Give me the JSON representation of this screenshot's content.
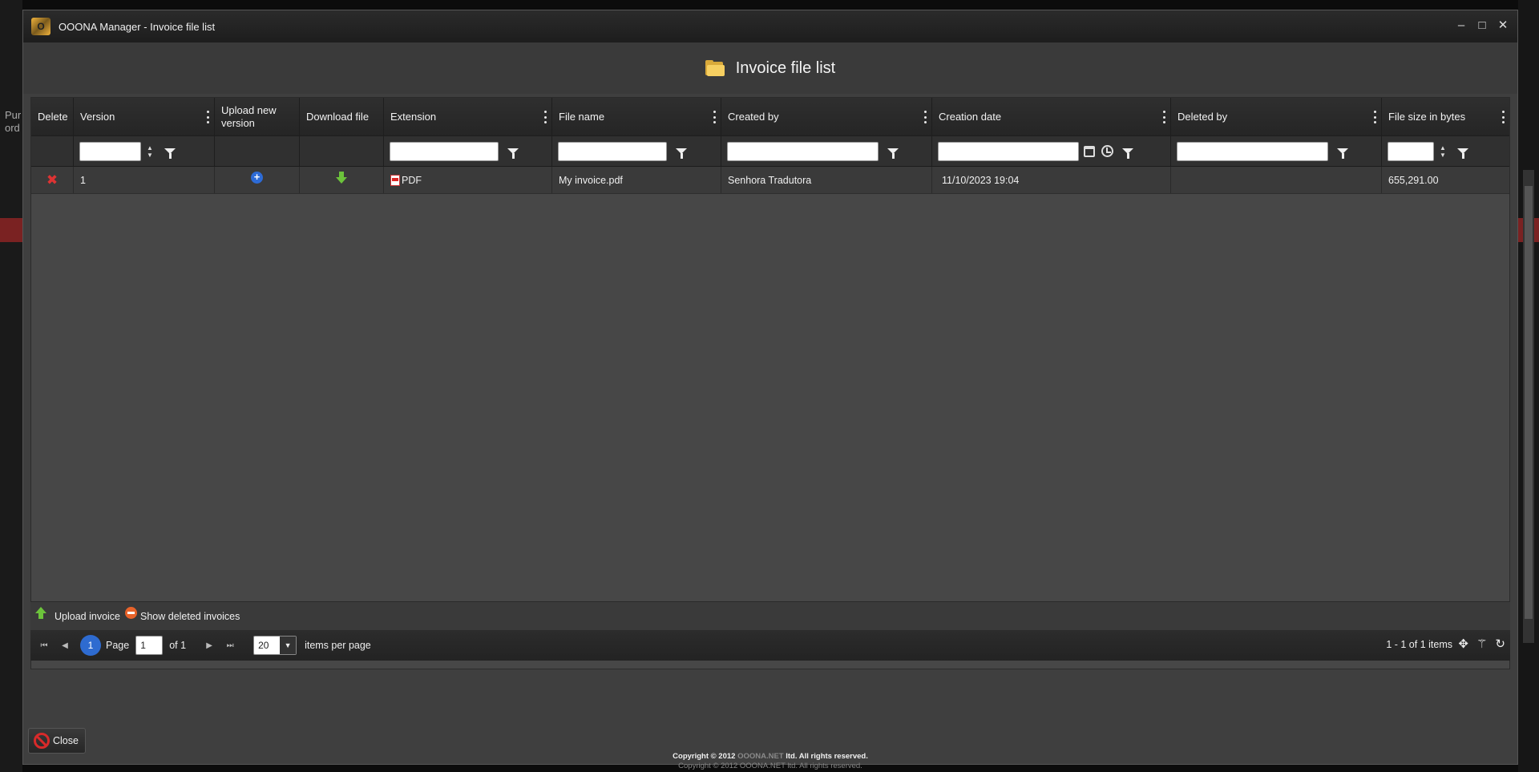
{
  "window": {
    "title": "OOONA Manager - Invoice file list",
    "logo_letter": "O",
    "controls": {
      "minimize": "–",
      "maximize": "□",
      "close": "✕"
    }
  },
  "background": {
    "text_line_1": "Pur",
    "text_line_2": "ord"
  },
  "header": {
    "title": "Invoice file list",
    "icon": "folder-icon"
  },
  "grid": {
    "columns": [
      {
        "key": "delete",
        "label": "Delete"
      },
      {
        "key": "version",
        "label": "Version"
      },
      {
        "key": "upload",
        "label": "Upload new version"
      },
      {
        "key": "download",
        "label": "Download file"
      },
      {
        "key": "extension",
        "label": "Extension"
      },
      {
        "key": "file_name",
        "label": "File name"
      },
      {
        "key": "created_by",
        "label": "Created by"
      },
      {
        "key": "creation_date",
        "label": "Creation date"
      },
      {
        "key": "deleted_by",
        "label": "Deleted by"
      },
      {
        "key": "file_size",
        "label": "File size in bytes"
      }
    ],
    "rows": [
      {
        "delete_icon": "✖",
        "version": "1",
        "upload_icon": "+",
        "extension": "PDF",
        "file_name": "My invoice.pdf",
        "created_by": "Senhora Tradutora",
        "creation_date": "11/10/2023 19:04",
        "deleted_by": "",
        "file_size": "655,291.00"
      }
    ]
  },
  "toolbar": {
    "upload_label": "Upload invoice",
    "show_deleted_label": "Show deleted invoices"
  },
  "pager": {
    "current_page": "1",
    "page_label": "Page",
    "page_input": "1",
    "of_label": "of 1",
    "page_size": "20",
    "items_per_page_label": "items per page",
    "info": "1 - 1 of 1 items",
    "first": "⏮",
    "prev": "◀",
    "next": "▶",
    "last": "⏭",
    "caret": "▼"
  },
  "footer": {
    "close_label": "Close",
    "copyright_prefix": "Copyright © 2012 ",
    "brand": "OOONA.NET",
    "copyright_suffix": " ltd. All rights reserved."
  },
  "colors": {
    "accent_blue": "#2e6bd0",
    "delete_red": "#d33333",
    "download_green": "#6cc33b",
    "folder_yellow": "#f6cf61"
  }
}
